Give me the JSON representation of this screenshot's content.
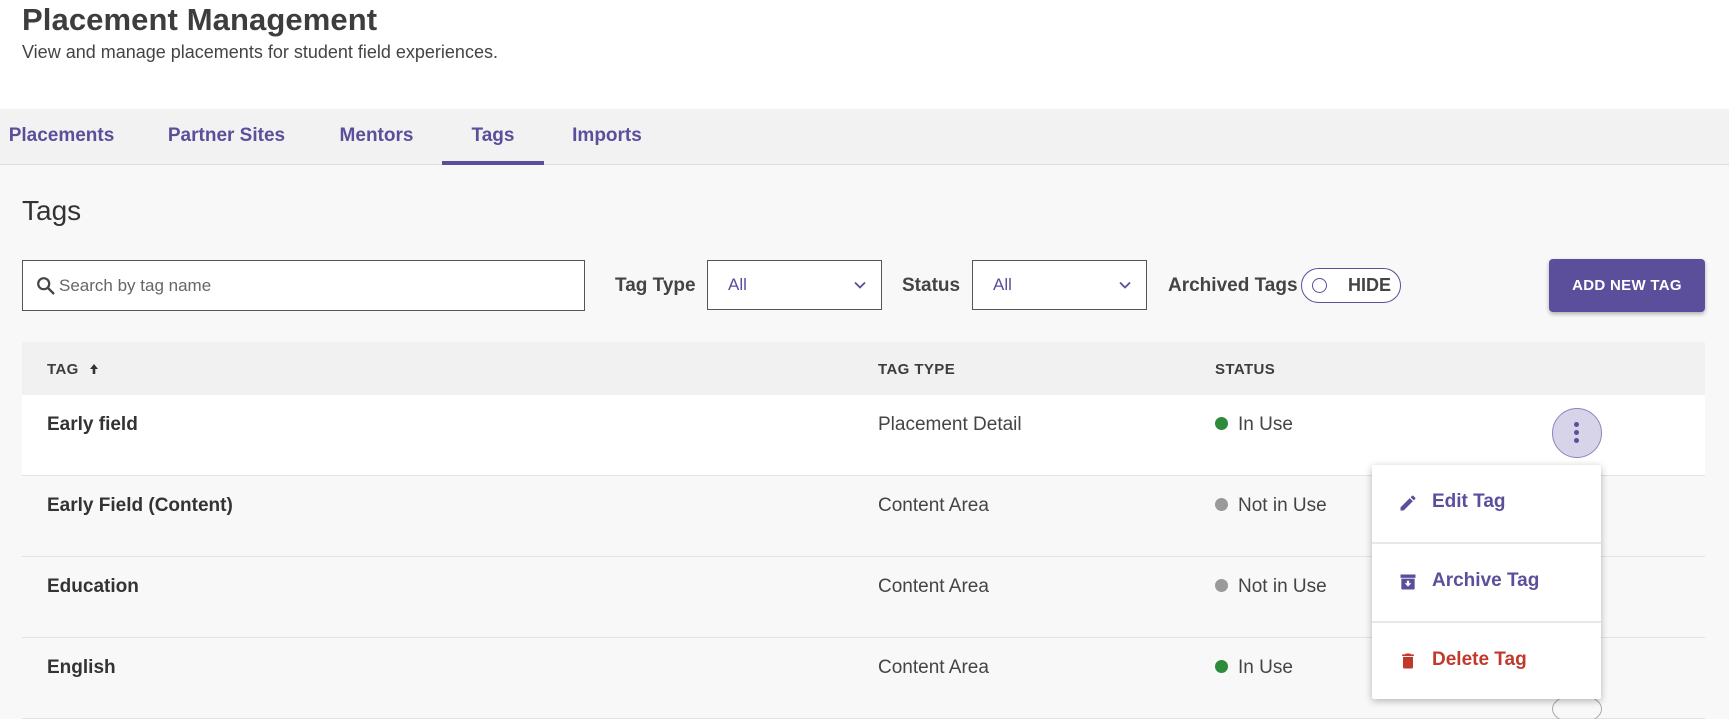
{
  "header": {
    "title": "Placement Management",
    "subtitle": "View and manage placements for student field experiences."
  },
  "tabs": [
    {
      "label": "Placements"
    },
    {
      "label": "Partner Sites"
    },
    {
      "label": "Mentors"
    },
    {
      "label": "Tags",
      "active": true
    },
    {
      "label": "Imports"
    }
  ],
  "section_title": "Tags",
  "search": {
    "placeholder": "Search by tag name",
    "value": ""
  },
  "filters": {
    "tag_type_label": "Tag Type",
    "tag_type_value": "All",
    "status_label": "Status",
    "status_value": "All",
    "archived_label": "Archived Tags",
    "archived_toggle": "HIDE"
  },
  "add_button": "ADD NEW TAG",
  "table": {
    "headers": {
      "tag": "TAG",
      "tag_type": "TAG TYPE",
      "status": "STATUS"
    },
    "sort": {
      "column": "tag",
      "direction": "ascending"
    },
    "rows": [
      {
        "tag": "Early field",
        "tag_type": "Placement Detail",
        "status": "In Use"
      },
      {
        "tag": "Early Field (Content)",
        "tag_type": "Content Area",
        "status": "Not in Use"
      },
      {
        "tag": "Education",
        "tag_type": "Content Area",
        "status": "Not in Use"
      },
      {
        "tag": "English",
        "tag_type": "Content Area",
        "status": "In Use"
      }
    ]
  },
  "menu": {
    "edit": "Edit Tag",
    "archive": "Archive Tag",
    "delete": "Delete Tag"
  },
  "colors": {
    "accent": "#5b4f9b",
    "in_use": "#2e8b3a",
    "not_in_use": "#9a9a9a",
    "danger": "#c0392b"
  },
  "icons": {
    "search": "search-icon",
    "chevron": "chevron-down-icon",
    "sort": "arrow-up-icon",
    "kebab": "more-vertical-icon",
    "edit": "pencil-icon",
    "archive": "archive-icon",
    "delete": "trash-icon"
  }
}
